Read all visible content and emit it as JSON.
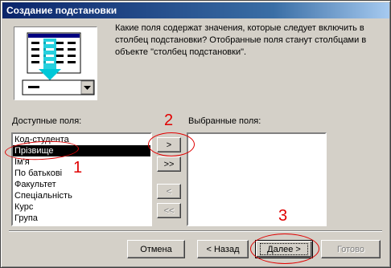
{
  "window": {
    "title": "Создание подстановки"
  },
  "description": "Какие поля содержат значения, которые следует включить в столбец подстановки? Отобранные поля станут столбцами в объекте \"столбец подстановки\".",
  "available": {
    "label": "Доступные поля:",
    "items": [
      "Код-студента",
      "Прізвище",
      "Ім'я",
      "По батькові",
      "Факультет",
      "Спеціальність",
      "Курс",
      "Група"
    ],
    "selected_index": 1
  },
  "selected": {
    "label": "Выбранные поля:",
    "items": []
  },
  "move_buttons": {
    "add_one": ">",
    "add_all": ">>",
    "remove_one": "<",
    "remove_all": "<<"
  },
  "footer": {
    "cancel": "Отмена",
    "back": "< Назад",
    "next": "Далее >",
    "finish": "Готово"
  },
  "annotations": {
    "marker_1": "1",
    "marker_2": "2",
    "marker_3": "3",
    "color": "#e00000"
  }
}
